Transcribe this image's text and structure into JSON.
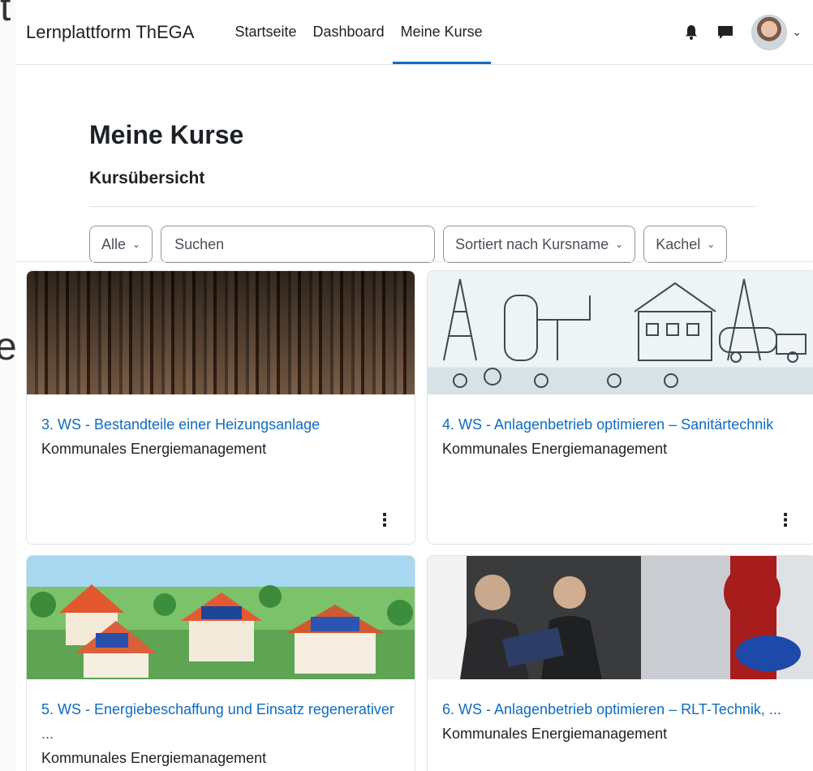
{
  "navbar": {
    "brand": "Lernplattform ThEGA",
    "links": [
      {
        "label": "Startseite",
        "active": false
      },
      {
        "label": "Dashboard",
        "active": false
      },
      {
        "label": "Meine Kurse",
        "active": true
      }
    ],
    "icons": [
      "bell-icon",
      "chat-icon",
      "avatar",
      "chevron-down-icon"
    ]
  },
  "page": {
    "title": "Meine Kurse",
    "section": "Kursübersicht"
  },
  "filters": {
    "grouping": "Alle",
    "search_placeholder": "Suchen",
    "sort": "Sortiert nach Kursname",
    "view": "Kachel"
  },
  "courses": [
    {
      "title": "3. WS - Bestandteile einer Heizungsanlage",
      "category": "Kommunales Energiemanagement"
    },
    {
      "title": "4. WS - Anlagenbetrieb optimieren – Sanitärtechnik",
      "category": "Kommunales Energiemanagement"
    },
    {
      "title": "5. WS - Energiebeschaffung und Einsatz regenerativer ...",
      "category": "Kommunales Energiemanagement"
    },
    {
      "title": "6. WS - Anlagenbetrieb optimieren – RLT-Technik, ...",
      "category": "Kommunales Energiemanagement"
    }
  ],
  "colors": {
    "link": "#0f6cbf",
    "active_underline": "#0f6cbf",
    "text": "#1d2125",
    "border": "#dee2e6"
  }
}
